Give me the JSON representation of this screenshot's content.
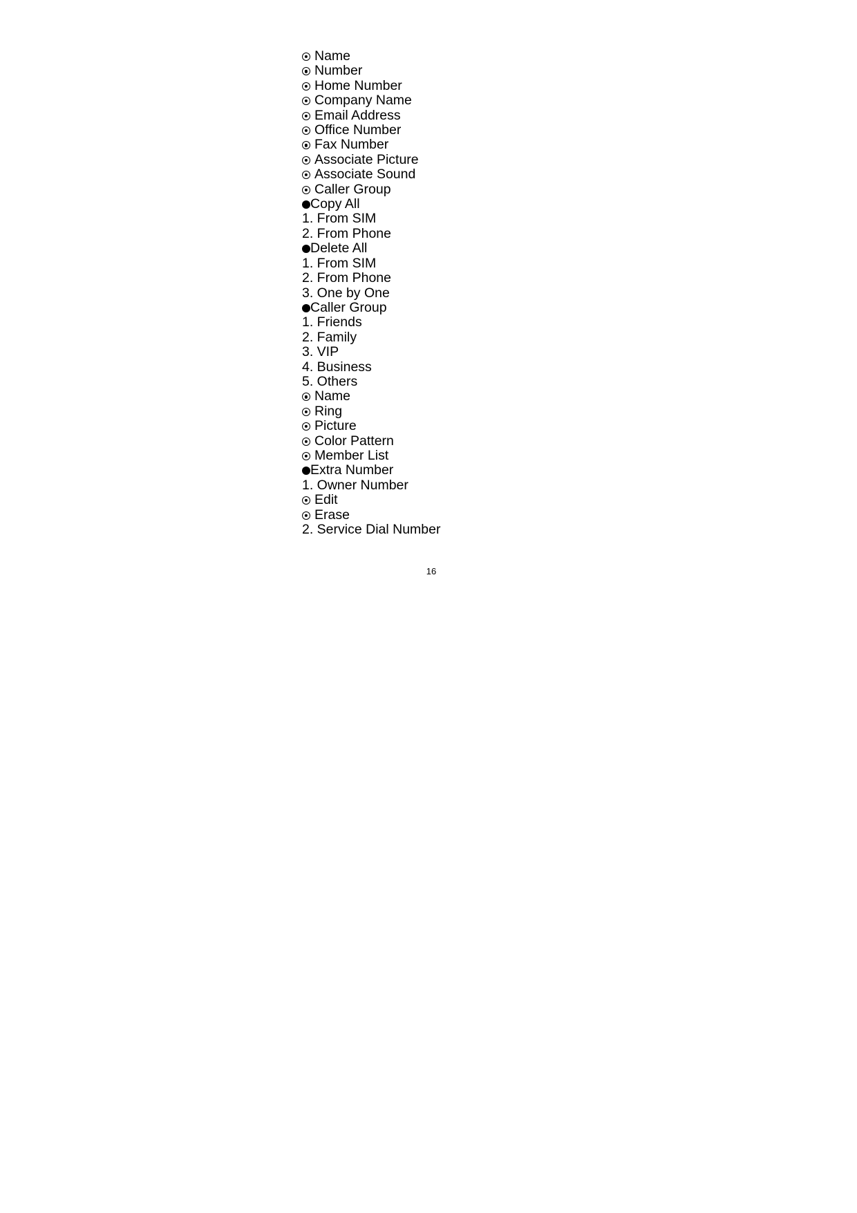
{
  "document": {
    "page_number": "16",
    "text_color": "#000000",
    "background_color": "#ffffff"
  },
  "menu_outline": {
    "lines": [
      {
        "marker": "circled-dot",
        "text": "Name"
      },
      {
        "marker": "circled-dot",
        "text": "Number"
      },
      {
        "marker": "circled-dot",
        "text": "Home Number"
      },
      {
        "marker": "circled-dot",
        "text": "Company Name"
      },
      {
        "marker": "circled-dot",
        "text": "Email Address"
      },
      {
        "marker": "circled-dot",
        "text": "Office Number"
      },
      {
        "marker": "circled-dot",
        "text": "Fax Number"
      },
      {
        "marker": "circled-dot",
        "text": "Associate Picture"
      },
      {
        "marker": "circled-dot",
        "text": "Associate Sound"
      },
      {
        "marker": "circled-dot",
        "text": "Caller Group"
      },
      {
        "marker": "filled-bullet",
        "text": "Copy All"
      },
      {
        "marker": "number",
        "text": "1. From SIM"
      },
      {
        "marker": "number",
        "text": "2. From Phone"
      },
      {
        "marker": "filled-bullet",
        "text": "Delete All"
      },
      {
        "marker": "number",
        "text": "1. From SIM"
      },
      {
        "marker": "number",
        "text": "2. From Phone"
      },
      {
        "marker": "number",
        "text": "3. One by One"
      },
      {
        "marker": "filled-bullet",
        "text": "Caller Group"
      },
      {
        "marker": "number",
        "text": "1. Friends"
      },
      {
        "marker": "number",
        "text": "2. Family"
      },
      {
        "marker": "number",
        "text": "3. VIP"
      },
      {
        "marker": "number",
        "text": "4. Business"
      },
      {
        "marker": "number",
        "text": "5. Others"
      },
      {
        "marker": "circled-dot",
        "text": "Name"
      },
      {
        "marker": "circled-dot",
        "text": "Ring"
      },
      {
        "marker": "circled-dot",
        "text": "Picture"
      },
      {
        "marker": "circled-dot",
        "text": "Color Pattern"
      },
      {
        "marker": "circled-dot",
        "text": "Member List"
      },
      {
        "marker": "filled-bullet",
        "text": "Extra Number"
      },
      {
        "marker": "number",
        "text": "1. Owner Number"
      },
      {
        "marker": "circled-dot",
        "text": "Edit"
      },
      {
        "marker": "circled-dot",
        "text": "Erase"
      },
      {
        "marker": "number",
        "text": "2. Service Dial Number"
      }
    ]
  }
}
